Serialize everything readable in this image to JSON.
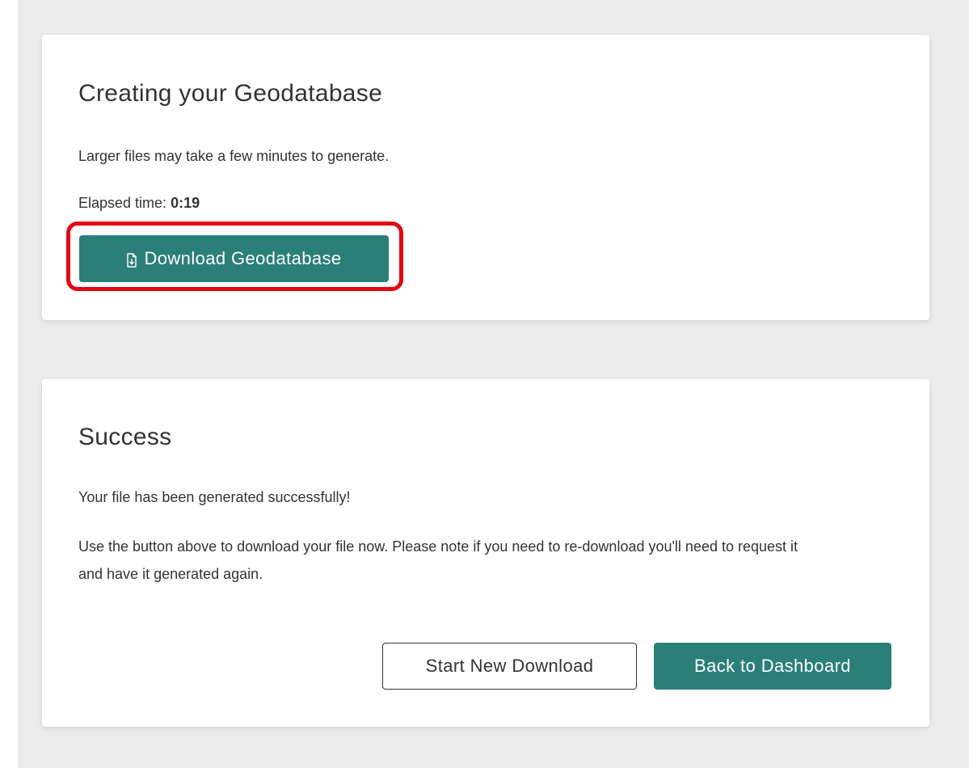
{
  "progress_card": {
    "title": "Creating your Geodatabase",
    "intro": "Larger files may take a few minutes to generate.",
    "elapsed_label": "Elapsed time: ",
    "elapsed_value": "0:19",
    "download_button_label": "Download Geodatabase",
    "download_button_icon": "file-download-icon",
    "highlight_color": "#e30613"
  },
  "success_card": {
    "title": "Success",
    "message": "Your file has been generated successfully!",
    "instructions": "Use the button above to download your file now. Please note if you need to re-download you'll need to request it and have it generated again.",
    "start_new_button_label": "Start New Download",
    "dashboard_button_label": "Back to Dashboard"
  },
  "colors": {
    "primary": "#2a7f79",
    "page_background": "#ebebeb",
    "card_background": "#ffffff",
    "text": "#333333"
  }
}
